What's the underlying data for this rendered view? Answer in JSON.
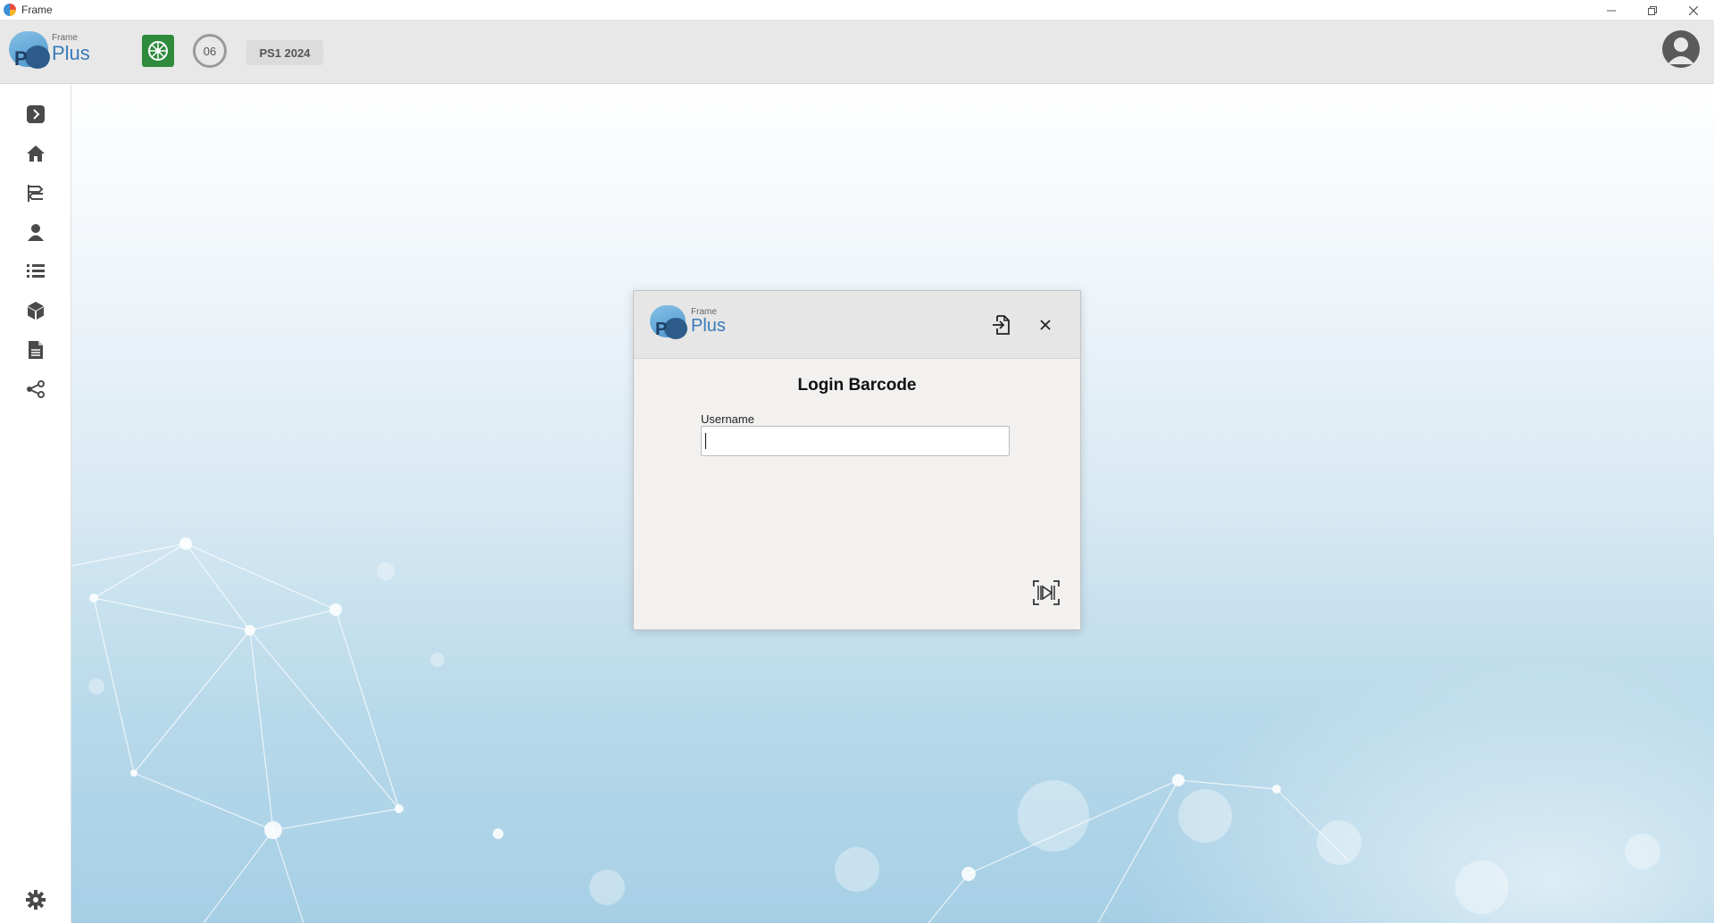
{
  "window": {
    "title": "Frame",
    "controls": {
      "minimize": "minimize-icon",
      "restore": "restore-icon",
      "close": "close-icon"
    }
  },
  "header": {
    "logo": {
      "small_text": "Frame",
      "large_text": "Plus",
      "letter": "P"
    },
    "badge_icon": "dharma-wheel-icon",
    "counter": "06",
    "season": "PS1 2024",
    "avatar_icon": "user-avatar-icon"
  },
  "sidebar": {
    "items": [
      {
        "name": "expand",
        "icon": "chevron-right-icon"
      },
      {
        "name": "home",
        "icon": "home-icon"
      },
      {
        "name": "routing",
        "icon": "route-icon"
      },
      {
        "name": "operator",
        "icon": "user-icon"
      },
      {
        "name": "list",
        "icon": "list-icon"
      },
      {
        "name": "products",
        "icon": "box-icon"
      },
      {
        "name": "documents",
        "icon": "document-icon"
      },
      {
        "name": "share",
        "icon": "share-icon"
      }
    ],
    "settings_icon": "gear-icon"
  },
  "dialog": {
    "logo": {
      "small_text": "Frame",
      "large_text": "Plus",
      "letter": "P"
    },
    "title": "Login Barcode",
    "username_label": "Username",
    "username_value": "",
    "login_icon": "login-icon",
    "close_icon": "close-icon",
    "scan_icon": "barcode-scan-icon"
  },
  "colors": {
    "header_bg": "#e8e8e8",
    "dialog_bg": "#f2f1ef",
    "accent_blue": "#3a7ab8",
    "badge_green": "#2e8b3c"
  }
}
